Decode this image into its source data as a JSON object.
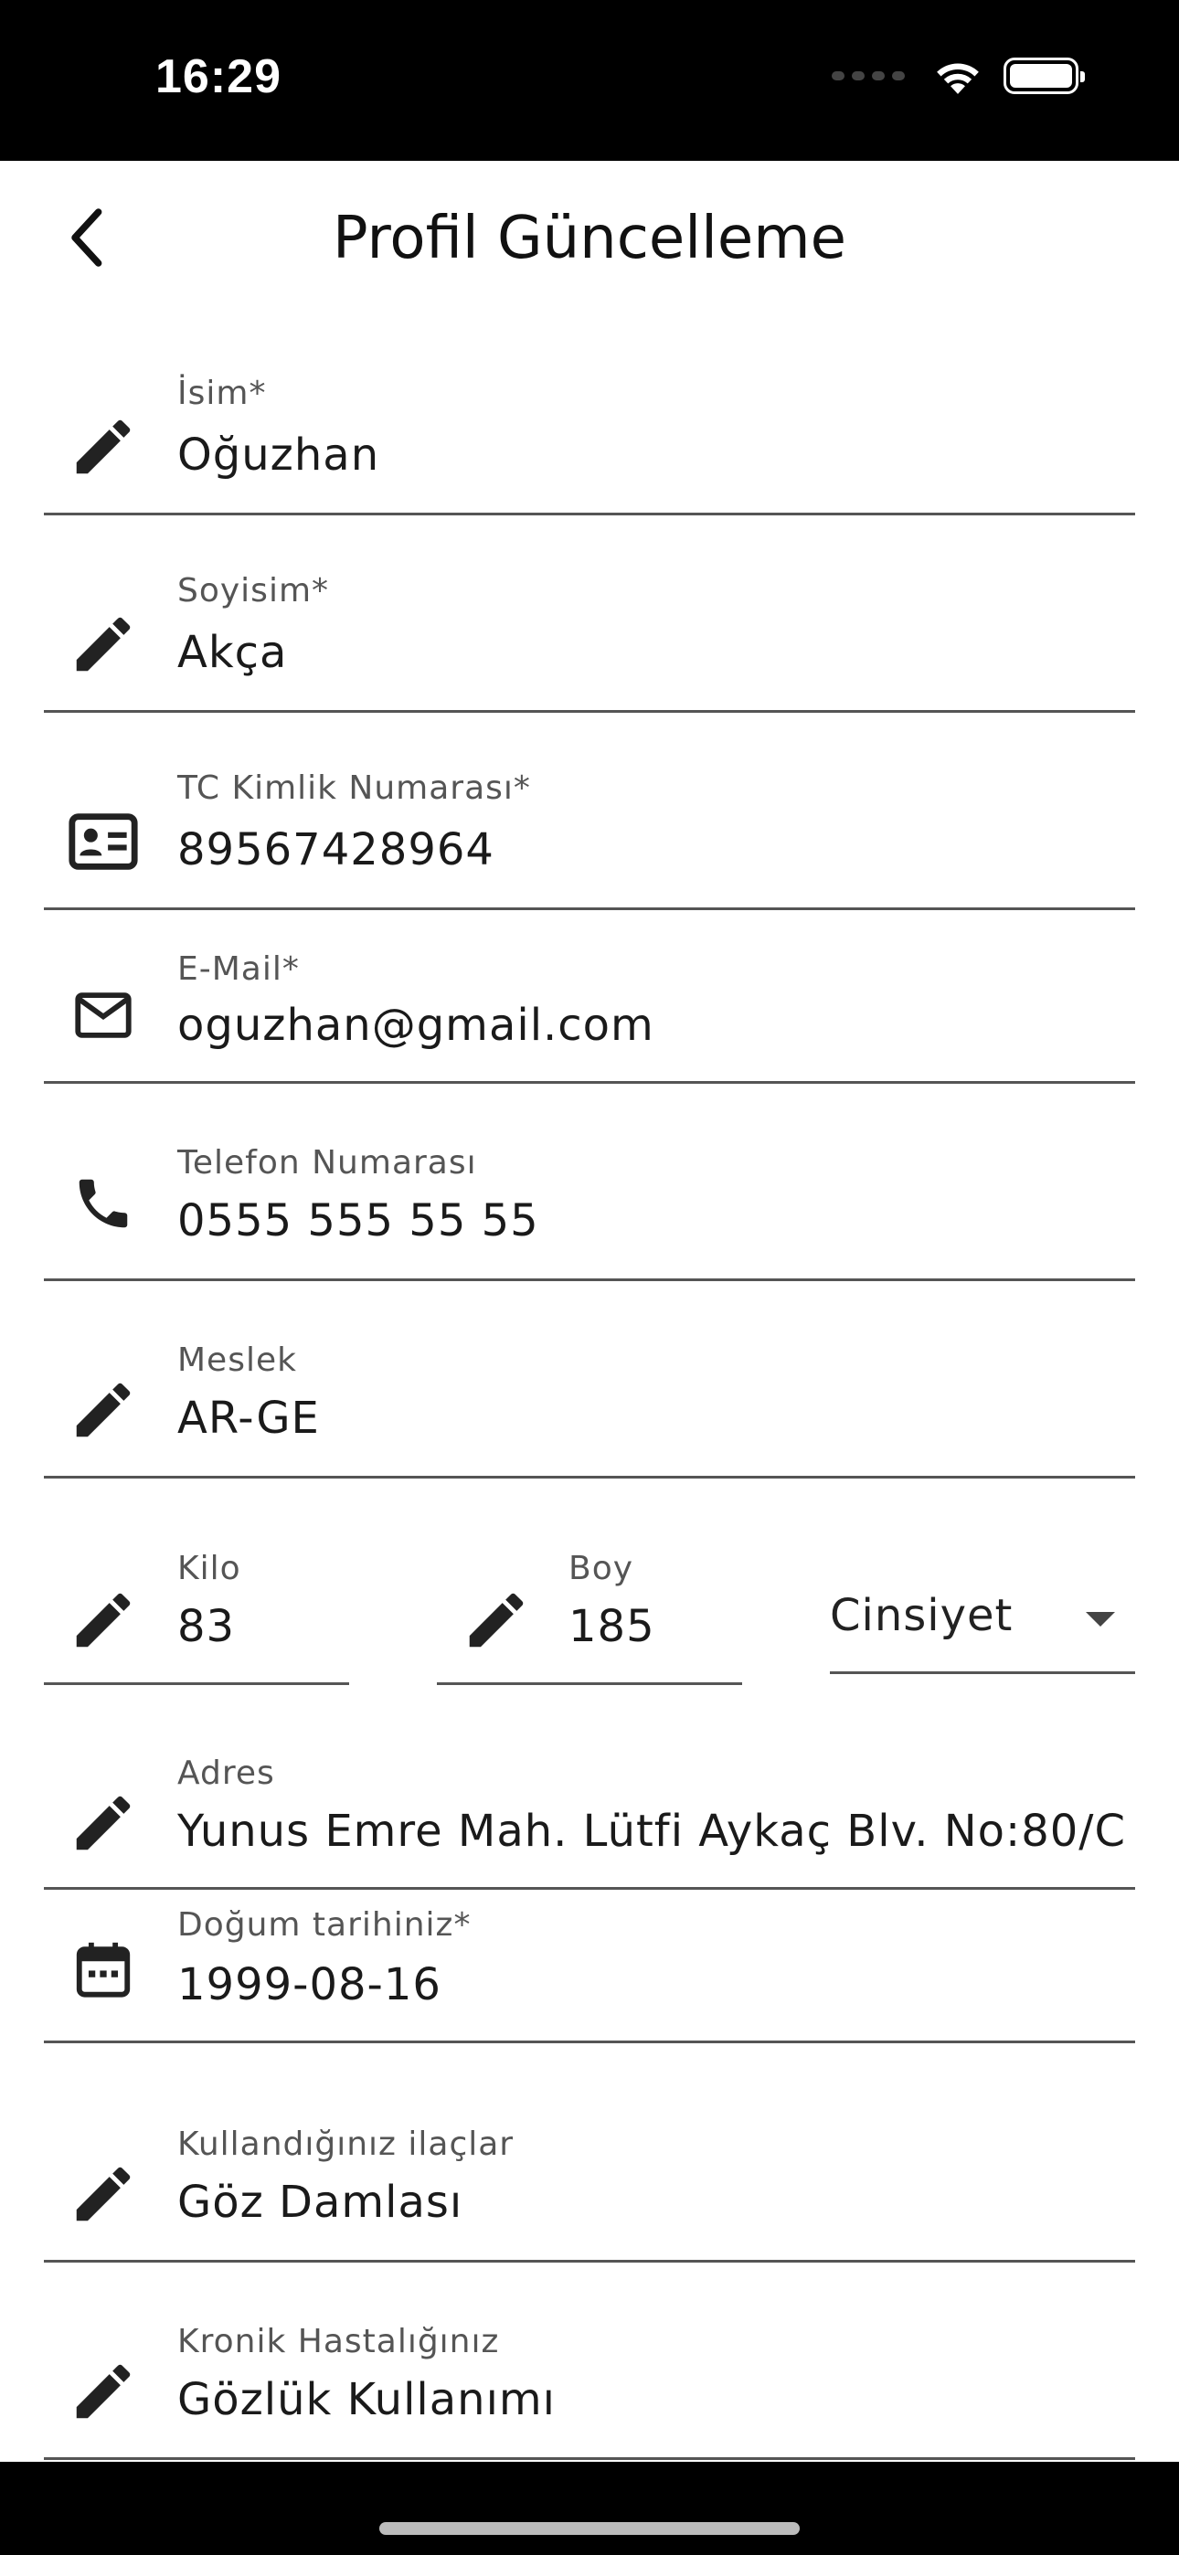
{
  "status": {
    "time": "16:29"
  },
  "header": {
    "title": "Profil Güncelleme"
  },
  "fields": {
    "name": {
      "label": "İsim*",
      "value": "Oğuzhan"
    },
    "surname": {
      "label": "Soyisim*",
      "value": "Akça"
    },
    "tc": {
      "label": "TC Kimlik Numarası*",
      "value": "89567428964"
    },
    "email": {
      "label": "E-Mail*",
      "value": "oguzhan@gmail.com"
    },
    "phone": {
      "label": "Telefon Numarası",
      "value": "0555 555 55 55"
    },
    "job": {
      "label": "Meslek",
      "value": "AR-GE"
    },
    "weight": {
      "label": "Kilo",
      "value": "83"
    },
    "height": {
      "label": "Boy",
      "value": "185"
    },
    "gender": {
      "placeholder": "Cinsiyet"
    },
    "address": {
      "label": "Adres",
      "value": "Yunus Emre Mah. Lütfi Aykaç Blv. No:80/C"
    },
    "birth": {
      "label": "Doğum tarihiniz*",
      "value": "1999-08-16"
    },
    "meds": {
      "label": "Kullandığınız ilaçlar",
      "value": "Göz Damlası"
    },
    "chronic": {
      "label": "Kronik Hastalığınız",
      "value": "Gözlük Kullanımı"
    }
  },
  "icons": {
    "back": "chevron-left-icon",
    "edit": "pencil-icon",
    "id": "id-card-icon",
    "mail": "mail-icon",
    "phone": "phone-icon",
    "calendar": "calendar-icon"
  }
}
